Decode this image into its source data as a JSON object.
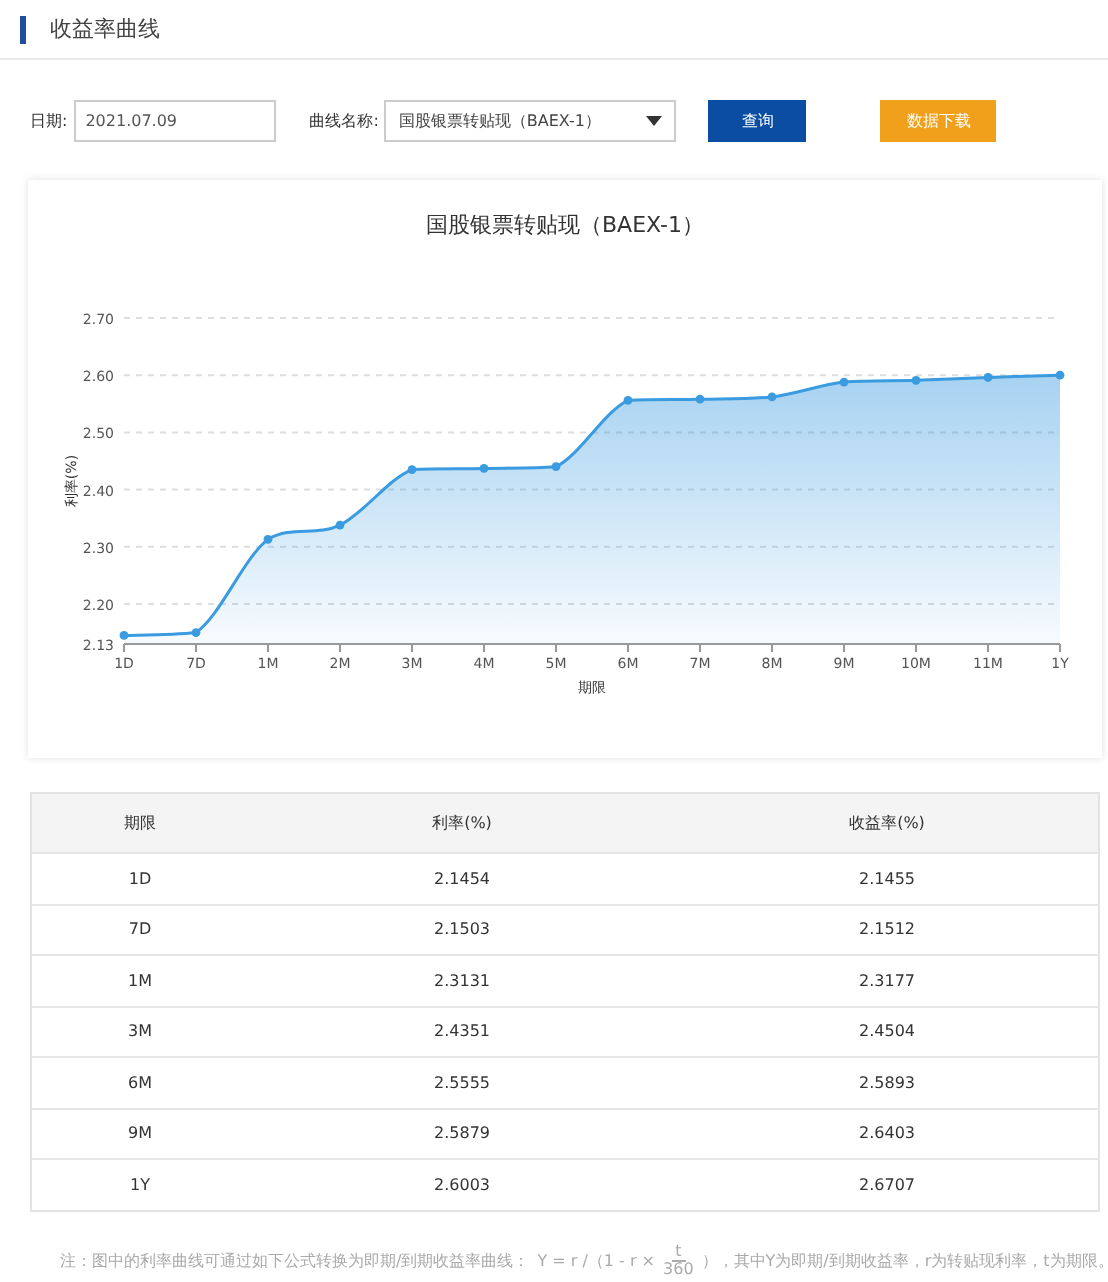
{
  "header": {
    "title": "收益率曲线"
  },
  "form": {
    "date_label": "日期:",
    "date_value": "2021.07.09",
    "curve_label": "曲线名称:",
    "curve_value": "国股银票转贴现（BAEX-1）",
    "query_button": "查询",
    "download_button": "数据下载"
  },
  "chart": {
    "chart_data": {
      "type": "area",
      "title": "国股银票转贴现（BAEX-1）",
      "xlabel": "期限",
      "ylabel": "利率(%)",
      "categories": [
        "1D",
        "7D",
        "1M",
        "2M",
        "3M",
        "4M",
        "5M",
        "6M",
        "7M",
        "8M",
        "9M",
        "10M",
        "11M",
        "1Y"
      ],
      "grid": true,
      "series": [
        {
          "color": "#3a9be0",
          "values": [
            2.145,
            2.15,
            2.313,
            2.338,
            2.435,
            2.437,
            2.44,
            2.556,
            2.558,
            2.562,
            2.588,
            2.591,
            2.596,
            2.6
          ]
        }
      ],
      "ylim": [
        2.13,
        2.7
      ],
      "yticks": [
        {
          "value": 2.13,
          "label": "2.13"
        },
        {
          "value": 2.2,
          "label": "2.20"
        },
        {
          "value": 2.3,
          "label": "2.30"
        },
        {
          "value": 2.4,
          "label": "2.40"
        },
        {
          "value": 2.5,
          "label": "2.50"
        },
        {
          "value": 2.6,
          "label": "2.60"
        },
        {
          "value": 2.7,
          "label": "2.70"
        }
      ]
    }
  },
  "table": {
    "columns": [
      "期限",
      "利率(%)",
      "收益率(%)"
    ],
    "rows": [
      [
        "1D",
        "2.1454",
        "2.1455"
      ],
      [
        "7D",
        "2.1503",
        "2.1512"
      ],
      [
        "1M",
        "2.3131",
        "2.3177"
      ],
      [
        "3M",
        "2.4351",
        "2.4504"
      ],
      [
        "6M",
        "2.5555",
        "2.5893"
      ],
      [
        "9M",
        "2.5879",
        "2.6403"
      ],
      [
        "1Y",
        "2.6003",
        "2.6707"
      ]
    ]
  },
  "note": {
    "text": "注：图中的利率曲线可通过如下公式转换为即期/到期收益率曲线：",
    "formula_lhs": "Y = r /（1 - r ×",
    "numerator": "t",
    "denominator": "360",
    "formula_rhs": "），其中Y为即期/到期收益率，r为转贴现利率，t为期限。"
  }
}
